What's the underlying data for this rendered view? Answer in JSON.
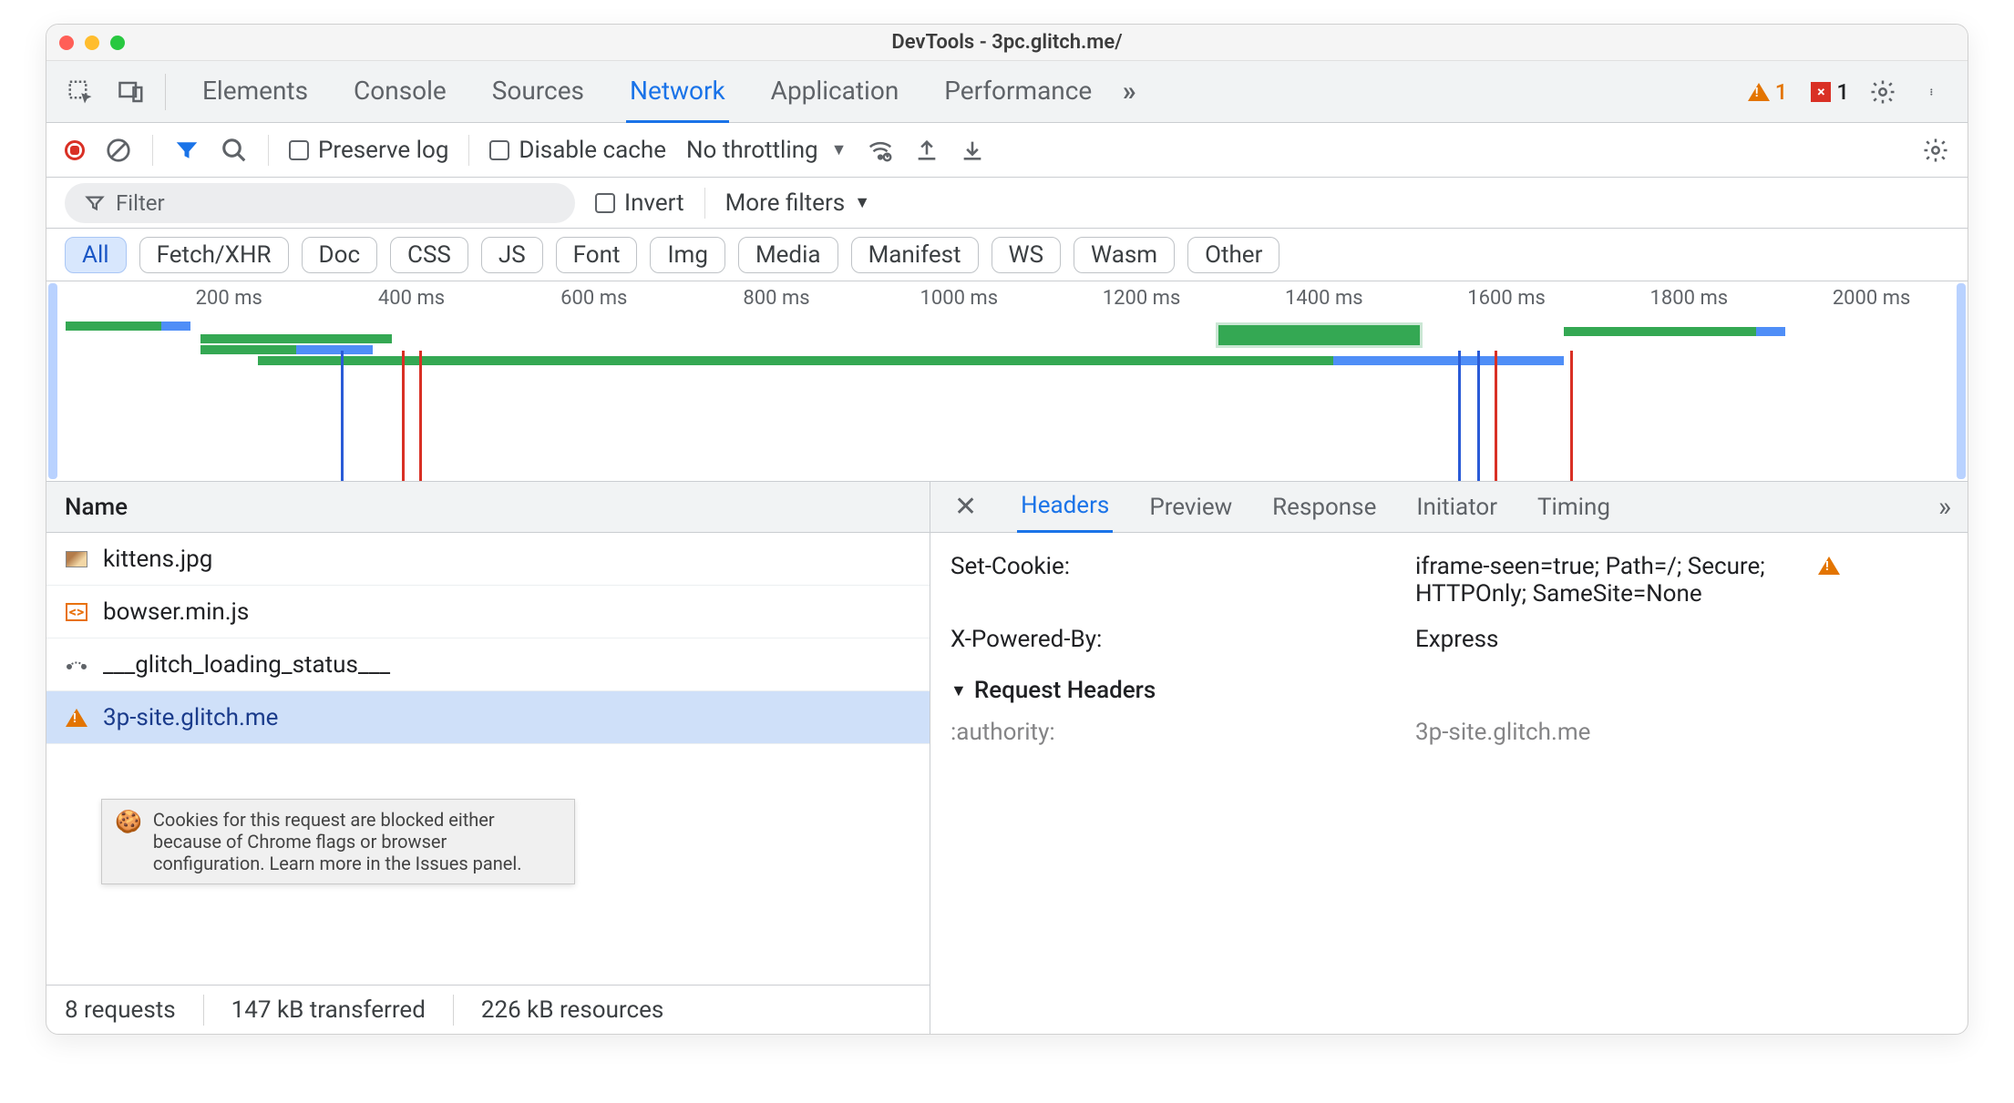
{
  "window": {
    "title": "DevTools - 3pc.glitch.me/"
  },
  "tabs": {
    "items": [
      "Elements",
      "Console",
      "Sources",
      "Network",
      "Application",
      "Performance"
    ],
    "active": "Network",
    "warn_count": "1",
    "err_count": "1"
  },
  "toolbar": {
    "preserve_log": "Preserve log",
    "disable_cache": "Disable cache",
    "throttling": "No throttling"
  },
  "filter": {
    "placeholder": "Filter",
    "invert": "Invert",
    "more": "More filters"
  },
  "types": [
    "All",
    "Fetch/XHR",
    "Doc",
    "CSS",
    "JS",
    "Font",
    "Img",
    "Media",
    "Manifest",
    "WS",
    "Wasm",
    "Other"
  ],
  "types_active": "All",
  "timeline": {
    "ticks": [
      "200 ms",
      "400 ms",
      "600 ms",
      "800 ms",
      "1000 ms",
      "1200 ms",
      "1400 ms",
      "1600 ms",
      "1800 ms",
      "2000 ms"
    ]
  },
  "requests": {
    "header": "Name",
    "items": [
      {
        "icon": "image",
        "name": "kittens.jpg"
      },
      {
        "icon": "js",
        "name": "bowser.min.js"
      },
      {
        "icon": "ws",
        "name": "___glitch_loading_status___"
      },
      {
        "icon": "warn",
        "name": "3p-site.glitch.me",
        "selected": true
      }
    ],
    "tooltip": "Cookies for this request are blocked either because of Chrome flags or browser configuration. Learn more in the Issues panel.",
    "footer": {
      "requests": "8 requests",
      "transferred": "147 kB transferred",
      "resources": "226 kB resources"
    }
  },
  "details": {
    "tabs": [
      "Headers",
      "Preview",
      "Response",
      "Initiator",
      "Timing"
    ],
    "active": "Headers",
    "response_headers": [
      {
        "key": "Set-Cookie:",
        "value": "iframe-seen=true; Path=/; Secure; HTTPOnly; SameSite=None",
        "warn": true
      },
      {
        "key": "X-Powered-By:",
        "value": "Express"
      }
    ],
    "request_section": "Request Headers",
    "request_headers": [
      {
        "key": ":authority:",
        "value": "3p-site.glitch.me"
      }
    ]
  }
}
